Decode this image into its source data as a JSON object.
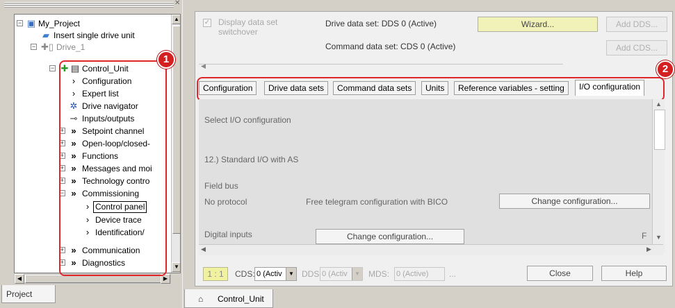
{
  "tree": {
    "project": "My_Project",
    "insert_drive": "Insert single drive unit",
    "drive": "Drive_1",
    "control_unit": "Control_Unit",
    "items": [
      {
        "label": "Configuration",
        "expand": ""
      },
      {
        "label": "Expert list",
        "expand": ""
      },
      {
        "label": "Drive navigator",
        "expand": ""
      },
      {
        "label": "Inputs/outputs",
        "expand": ""
      },
      {
        "label": "Setpoint channel",
        "expand": "+"
      },
      {
        "label": "Open-loop/closed-",
        "expand": "+"
      },
      {
        "label": "Functions",
        "expand": "+"
      },
      {
        "label": "Messages and moi",
        "expand": "+"
      },
      {
        "label": "Technology contro",
        "expand": "+"
      },
      {
        "label": "Commissioning",
        "expand": "-"
      }
    ],
    "sub_items": [
      "Control panel",
      "Device trace",
      "Identification/"
    ],
    "bottom_items": [
      "Communication",
      "Diagnostics"
    ]
  },
  "left_tab": "Project",
  "badges": {
    "one": "1",
    "two": "2"
  },
  "header": {
    "display_switchover": "Display data set switchover",
    "drive_data_set": "Drive data set: DDS 0 (Active)",
    "command_data_set": "Command data set: CDS 0 (Active)",
    "wizard": "Wizard...",
    "add_dds": "Add DDS...",
    "add_cds": "Add CDS..."
  },
  "tabs": [
    "Configuration",
    "Drive data sets",
    "Command data sets",
    "Units",
    "Reference variables - setting",
    "I/O configuration"
  ],
  "content": {
    "select_io": "Select I/O configuration",
    "standard_io": "12.) Standard I/O with AS",
    "field_bus": "Field bus",
    "no_protocol": "No protocol",
    "free_telegram": "Free telegram configuration with BICO",
    "change_config_1": "Change configuration...",
    "digital_inputs": "Digital inputs",
    "change_config_2": "Change configuration...",
    "cut_text": "F"
  },
  "status": {
    "ratio": "1 : 1",
    "cds_label": "CDS:",
    "cds_value": "0 (Activ",
    "dds_label": "DDS:",
    "dds_value": "0 (Activ",
    "mds_label": "MDS:",
    "mds_value": "0 (Active)",
    "ellipsis": "...",
    "close": "Close",
    "help": "Help"
  },
  "bottom_tab": "Control_Unit",
  "colors": {
    "highlight": "#e0262b",
    "wizard": "#f0f2b8",
    "ratio": "#f0f2a0"
  }
}
